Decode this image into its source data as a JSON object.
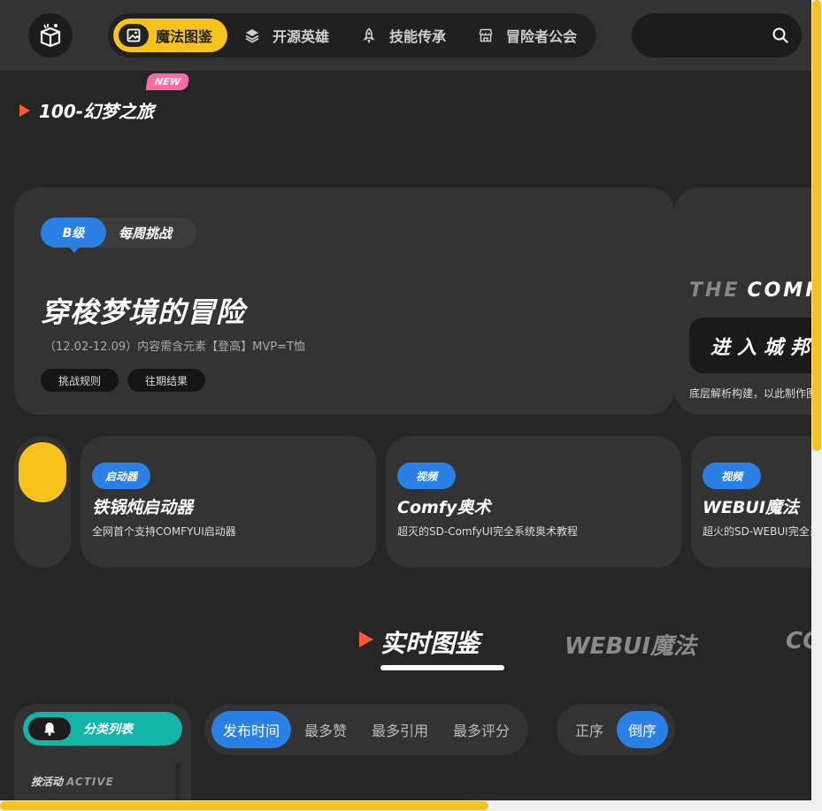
{
  "nav": {
    "items": [
      {
        "label": "魔法图鉴",
        "icon": "image-icon"
      },
      {
        "label": "开源英雄",
        "icon": "layers-icon"
      },
      {
        "label": "技能传承",
        "icon": "rocket-icon"
      },
      {
        "label": "冒险者公会",
        "icon": "store-icon"
      }
    ],
    "search_placeholder": ""
  },
  "section": {
    "title": "100-幻梦之旅",
    "badge": "NEW"
  },
  "hero": {
    "level": "B级",
    "tag": "每周挑战",
    "title": "穿梭梦境的冒险",
    "subtitle": "（12.02-12.09）内容需含元素【登高】MVP=T恤",
    "btn_rules": "挑战规则",
    "btn_results": "往期结果"
  },
  "hero2": {
    "the": "THE",
    "com": "COMFY",
    "enter": "进入城邦",
    "desc": "底层解析构建，以此制作图像"
  },
  "cards": [
    {
      "tag": "启动器",
      "title": "铁锅炖启动器",
      "desc": "全网首个支持COMFYUI启动器"
    },
    {
      "tag": "视频",
      "title": "Comfy奥术",
      "desc": "超灭的SD-ComfyUI完全系统奥术教程"
    },
    {
      "tag": "视频",
      "title": "WEBUI魔法",
      "desc": "超火的SD-WEBUI完全系统魔法教程"
    }
  ],
  "tabs": {
    "active": "实时图鉴",
    "second": "WEBUI魔法",
    "third": "COMFY"
  },
  "sidebar": {
    "category_label": "分类列表",
    "by_activity": "按活动",
    "by_activity_en": "ACTIVE"
  },
  "sort": {
    "items": [
      "发布时间",
      "最多赞",
      "最多引用",
      "最多评分"
    ]
  },
  "order": {
    "items": [
      "正序",
      "倒序"
    ]
  },
  "colors": {
    "accent_yellow": "#f7c21b",
    "accent_blue": "#2b80e5",
    "accent_teal": "#13b5a6",
    "accent_red": "#ff5a36",
    "badge_pink": "#ff6aa6"
  }
}
